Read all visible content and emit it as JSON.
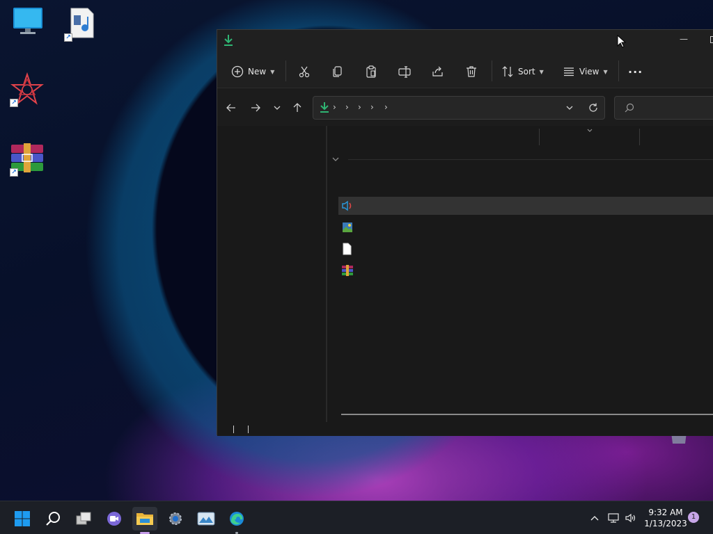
{
  "toolbar": {
    "new_label": "New",
    "sort_label": "Sort",
    "view_label": "View",
    "more_label": "···"
  },
  "window": {
    "minimize_glyph": "—"
  },
  "taskbar": {
    "time": "9:32 AM",
    "date": "1/13/2023",
    "notification_count": "1"
  },
  "colors": {
    "accent_download": "#2fb573",
    "accent_windows": "#1e9bf0"
  }
}
